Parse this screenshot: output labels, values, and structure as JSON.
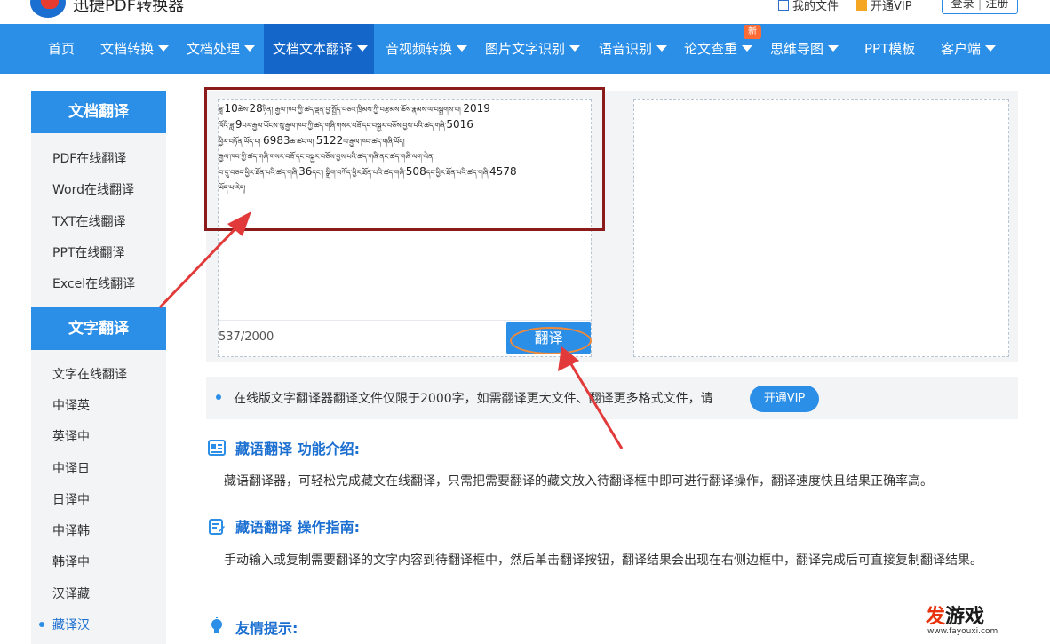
{
  "header": {
    "brand": "迅捷PDF转换器",
    "my_files": "我的文件",
    "open_vip": "开通VIP",
    "login": "登录",
    "register": "注册"
  },
  "nav": {
    "items": [
      {
        "label": "首页"
      },
      {
        "label": "文档转换"
      },
      {
        "label": "文档处理"
      },
      {
        "label": "文档文本翻译"
      },
      {
        "label": "音视频转换"
      },
      {
        "label": "图片文字识别"
      },
      {
        "label": "语音识别"
      },
      {
        "label": "论文查重"
      },
      {
        "label": "思维导图"
      },
      {
        "label": "PPT模板"
      },
      {
        "label": "客户端"
      }
    ],
    "new_badge": "新"
  },
  "sidebar": {
    "doc_heading": "文档翻译",
    "doc_items": [
      "PDF在线翻译",
      "Word在线翻译",
      "TXT在线翻译",
      "PPT在线翻译",
      "Excel在线翻译"
    ],
    "text_heading": "文字翻译",
    "text_items": [
      "文字在线翻译",
      "中译英",
      "英译中",
      "中译日",
      "日译中",
      "中译韩",
      "韩译中",
      "汉译藏",
      "藏译汉"
    ]
  },
  "editor": {
    "line1_a": "ཟླ་",
    "n1": "10",
    "line1_b": "ཚེས་",
    "n2": "28",
    "line1_c": "ཉིན། རྒྱལ་ཁབ་ཀྱི་ཚད་ལྡན་བྱ་སྤྱོད་བཅའ་ཁྲིམས་ཀྱི་བརྩམས་ཆོས་རྣམས་ལ་བསྒྲགས་པ།",
    "n3": "2019",
    "line2_a": "ལོའི་ཟླ་",
    "n4": "9",
    "line2_b": "པར་རྒྱལ་ཡོངས་སུ་རྒྱལ་ཁབ་ཀྱི་ཚད་གཞི་གསར་བཟོ་དང་བསྐྱར་བཅོས་བྱས་པའི་ཚད་གཞི་",
    "n5": "5016",
    "line3_a": "ཕྱིར་བཏོན་ཡོད་པ། ",
    "n6": "6983",
    "line3_b": "ཆ་ཚང་ལ། ",
    "n7": "5122",
    "line3_c": "ལ་རྒྱལ་ཁབ་ཚད་གཞི་ཡོད།",
    "line4": "རྒྱལ་ཁབ་ཀྱི་ཚད་གཞི་གསར་བཟོ་དང་བསྐྱར་བཅོས་བྱས་པའི་ཚད་གཞི་ནང་ཚད་གཞི་ལག་ལེན་",
    "line5_a": "བ་དུ་བཅད་ཕྱིར་ཐོན་པའི་ཚད་གཞི་",
    "n8": "36",
    "line5_b": "དང་། སྒྲིག་བཀོད་ཕྱིར་ཐོན་པའི་ཚད་གཞི་",
    "n9": "508",
    "line5_c": "དང་ཕྱིར་ཐོན་པའི་ཚད་གཞི་",
    "n10": "4578",
    "line6": "ཡོད་པ་རེད།",
    "counter": "537/2000",
    "translate_label": "翻译"
  },
  "notice": {
    "text": "在线版文字翻译器翻译文件仅限于2000字，如需翻译更大文件、翻译更多格式文件，请",
    "vip_button": "开通VIP"
  },
  "sections": {
    "intro_title": "藏语翻译 功能介绍:",
    "intro_text": "藏语翻译器，可轻松完成藏文在线翻译，只需把需要翻译的藏文放入待翻译框中即可进行翻译操作，翻译速度快且结果正确率高。",
    "guide_title": "藏语翻译 操作指南:",
    "guide_text": "手动输入或复制需要翻译的文字内容到待翻译框中，然后单击翻译按钮，翻译结果会出现在右侧边框中，翻译完成后可直接复制翻译结果。",
    "tip_title": "友情提示:"
  },
  "watermark": {
    "big_a": "发",
    "big_b": "游戏",
    "small": "www.fayouxi.com"
  },
  "colors": {
    "nav_blue": "#2b8fe8",
    "nav_active": "#1466c9",
    "title_blue": "#1b6fd1",
    "frame_red": "#8b1a1a",
    "arrow_red": "#e23a3a",
    "ring_orange": "#f08a3a"
  }
}
